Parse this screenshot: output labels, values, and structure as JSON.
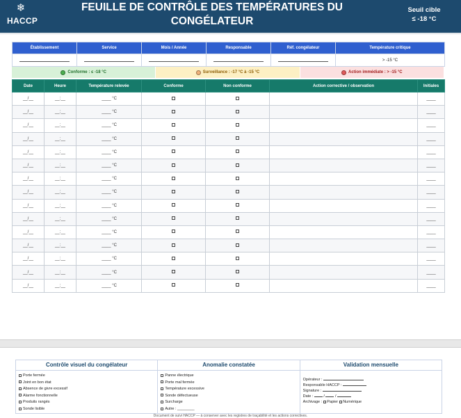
{
  "header": {
    "logo_text": "HACCP",
    "logo_icon": "snowflake-icon",
    "title": "FEUILLE DE CONTRÔLE DES TEMPÉRATURES DU CONGÉLATEUR",
    "seuil_label": "Seuil cible",
    "seuil_value": "≤ -18 °C"
  },
  "colors": {
    "header_bg": "#1d4a6e",
    "info_header_bg": "#2f5fcf",
    "log_header_bg": "#167a6a",
    "conforme": "#4caf50",
    "surveillance": "#f0b27a",
    "action": "#e05a5a"
  },
  "info": {
    "headers": [
      "Établissement",
      "Service",
      "Mois / Année",
      "Responsable",
      "Réf. congélateur",
      "Température critique"
    ],
    "critical_temp": "> -15 °C"
  },
  "legend": [
    {
      "label": "Conforme : ≤ -18 °C",
      "color": "#4caf50"
    },
    {
      "label": "Surveillance : -17 °C à -15 °C",
      "color": "#f0b27a"
    },
    {
      "label": "Action immédiate : > -15 °C",
      "color": "#e05a5a"
    }
  ],
  "log": {
    "headers": [
      "Date",
      "Heure",
      "Température relevée",
      "Conforme",
      "Non conforme",
      "Action corrective / observation",
      "Initiales"
    ],
    "date_placeholder": "__/__",
    "time_placeholder": "__:__",
    "temp_placeholder": "____ °C",
    "initials_placeholder": "____",
    "row_count": 15
  },
  "bottom": {
    "controle": {
      "title": "Contrôle visuel du congélateur",
      "items": [
        "Porte fermée",
        "Joint en bon état",
        "Absence de givre excessif",
        "Alarme fonctionnelle",
        "Produits rangés",
        "Sonde lisible"
      ]
    },
    "anomalie": {
      "title": "Anomalie constatée",
      "items": [
        "Panne électrique",
        "Porte mal fermée",
        "Température excessive",
        "Sonde défectueuse",
        "Surcharge",
        "Autre : ________"
      ]
    },
    "validation": {
      "title": "Validation mensuelle",
      "operateur": "Opérateur :",
      "responsable": "Responsable HACCP :",
      "signature": "Signature :",
      "date": "Date :",
      "archivage": "Archivage :",
      "papier": "Papier",
      "numerique": "Numérique"
    }
  },
  "footer": "Document de suivi HACCP — à conserver avec les registres de traçabilité et les actions correctives."
}
